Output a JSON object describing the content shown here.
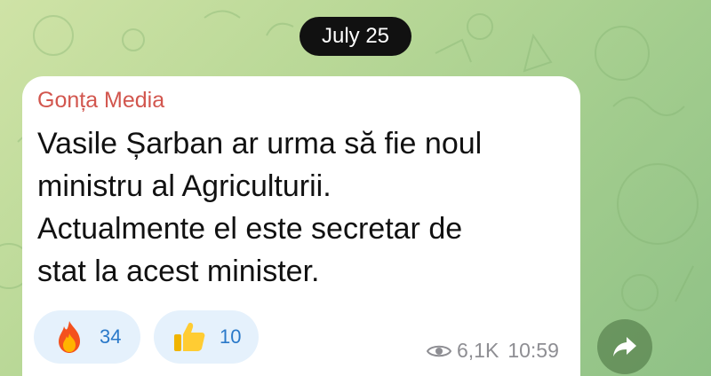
{
  "date_separator": "July 25",
  "message": {
    "sender": "Gonța Media",
    "text": "Vasile Șarban ar urma să fie noul\nministru al Agriculturii.\nActualmente el este secretar de\nstat la acest minister.",
    "views": "6,1K",
    "time": "10:59"
  },
  "reactions": [
    {
      "icon": "fire-emoji-icon",
      "count": "34"
    },
    {
      "icon": "thumbs-up-emoji-icon",
      "count": "10"
    }
  ],
  "colors": {
    "sender": "#d2564e",
    "reaction_bg": "#e5f1fc",
    "reaction_count": "#2a79c9",
    "meta": "#8e8e93"
  }
}
